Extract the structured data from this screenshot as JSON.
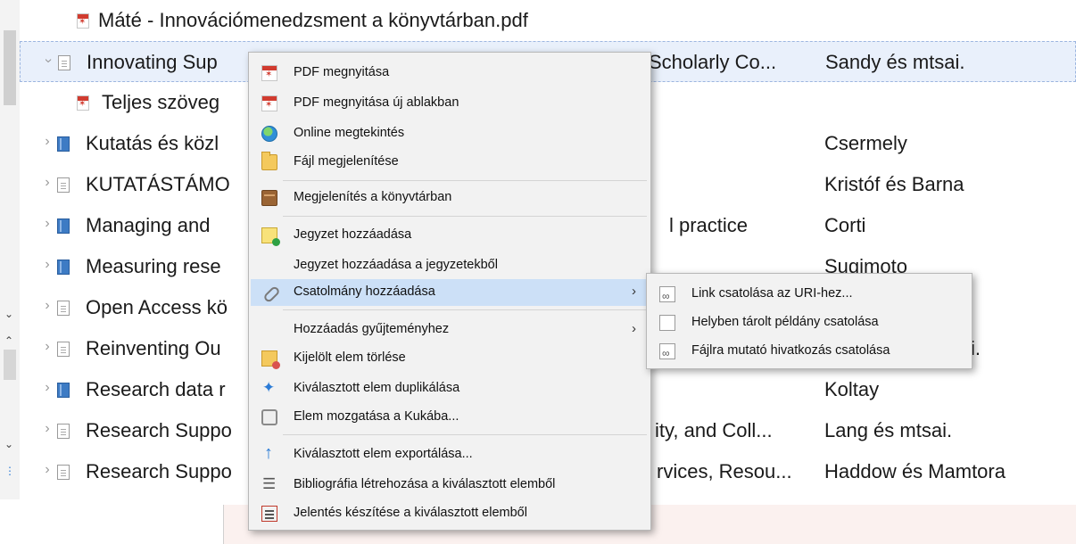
{
  "items": [
    {
      "icon": "pdf-icon",
      "title": "Máté - Innovációmenedzsment a könyvtárban.pdf",
      "author": "",
      "middle": ""
    },
    {
      "icon": "document-icon",
      "title": "Innovating Sup",
      "middle": "Scholarly Co...",
      "author": "Sandy és mtsai."
    },
    {
      "icon": "pdf-icon",
      "title": "Teljes szöveg",
      "middle": "",
      "author": ""
    },
    {
      "icon": "book-icon",
      "title": "Kutatás és közl",
      "middle": "",
      "author": "Csermely"
    },
    {
      "icon": "document-icon",
      "title": "KUTATÁSTÁMO",
      "middle": "",
      "author": "Kristóf és Barna"
    },
    {
      "icon": "book-icon",
      "title": "Managing and",
      "middle": "l practice",
      "author": "Corti"
    },
    {
      "icon": "book-icon",
      "title": "Measuring rese",
      "middle": "",
      "author": "Sugimoto"
    },
    {
      "icon": "document-icon",
      "title": "Open Access kö",
      "middle": "",
      "author": ""
    },
    {
      "icon": "document-icon",
      "title": "Reinventing Ou",
      "middle": "",
      "author": "i."
    },
    {
      "icon": "book-icon",
      "title": "Research data r",
      "middle": "",
      "author": "Koltay"
    },
    {
      "icon": "document-icon",
      "title": "Research Suppo",
      "middle": "ity, and Coll...",
      "author": "Lang és mtsai."
    },
    {
      "icon": "document-icon",
      "title": "Research Suppo",
      "middle": "rvices, Resou...",
      "author": "Haddow és Mamtora"
    }
  ],
  "menu": {
    "open_pdf": "PDF megnyitása",
    "open_pdf_new_window": "PDF megnyitása új ablakban",
    "view_online": "Online megtekintés",
    "show_file": "Fájl megjelenítése",
    "show_in_library": "Megjelenítés a könyvtárban",
    "add_note": "Jegyzet hozzáadása",
    "add_note_from_notes": "Jegyzet hozzáadása a jegyzetekből",
    "add_attachment": "Csatolmány hozzáadása",
    "add_to_collection": "Hozzáadás gyűjteményhez",
    "delete_selected": "Kijelölt elem törlése",
    "duplicate_selected": "Kiválasztott elem duplikálása",
    "move_to_trash": "Elem mozgatása a Kukába...",
    "export_selected": "Kiválasztott elem exportálása...",
    "create_bibliography": "Bibliográfia létrehozása a kiválasztott elemből",
    "generate_report": "Jelentés készítése a kiválasztott elemből",
    "submenu_arrow": "›"
  },
  "submenu": {
    "attach_link_uri": "Link csatolása az URI-hez...",
    "attach_stored_copy": "Helyben tárolt példány csatolása",
    "attach_link_to_file": "Fájlra mutató hivatkozás csatolása"
  }
}
